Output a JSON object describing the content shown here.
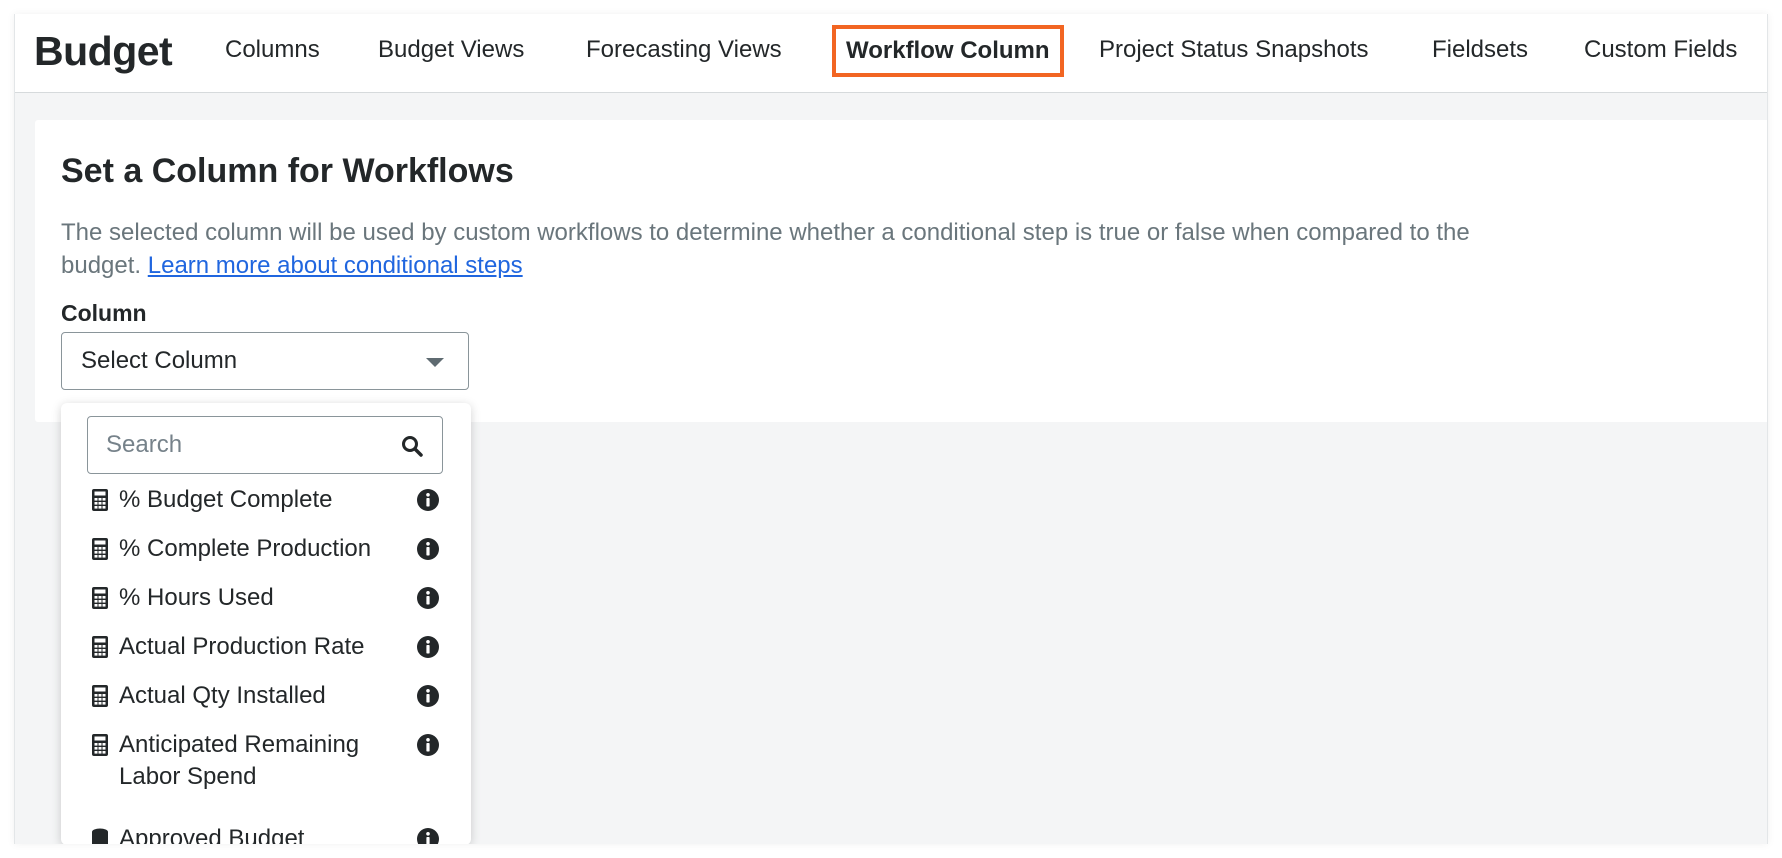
{
  "header": {
    "app_title": "Budget",
    "tabs": [
      {
        "label": "Columns"
      },
      {
        "label": "Budget Views"
      },
      {
        "label": "Forecasting Views"
      },
      {
        "label": "Workflow Column",
        "active": true
      },
      {
        "label": "Project Status Snapshots"
      },
      {
        "label": "Fieldsets"
      },
      {
        "label": "Custom Fields"
      }
    ]
  },
  "card": {
    "title": "Set a Column for Workflows",
    "description": "The selected column will be used by custom workflows to determine whether a conditional step is true or false when compared to the budget.",
    "link_label": "Learn more about conditional steps",
    "field_label": "Column",
    "select_value": "Select Column"
  },
  "dropdown": {
    "search_placeholder": "Search",
    "items": [
      {
        "label": "% Budget Complete",
        "icon": "calculator-icon"
      },
      {
        "label": "% Complete Production",
        "icon": "calculator-icon"
      },
      {
        "label": "% Hours Used",
        "icon": "calculator-icon"
      },
      {
        "label": "Actual Production Rate",
        "icon": "calculator-icon"
      },
      {
        "label": "Actual Qty Installed",
        "icon": "calculator-icon"
      },
      {
        "label": "Anticipated Remaining Labor Spend",
        "icon": "calculator-icon"
      },
      {
        "label": "Approved Budget",
        "icon": "database-icon"
      }
    ]
  },
  "colors": {
    "accent_active_tab": "#f26522",
    "link": "#2066df",
    "text": "#232729",
    "muted_text": "#6a767c",
    "background": "#f4f5f6"
  }
}
